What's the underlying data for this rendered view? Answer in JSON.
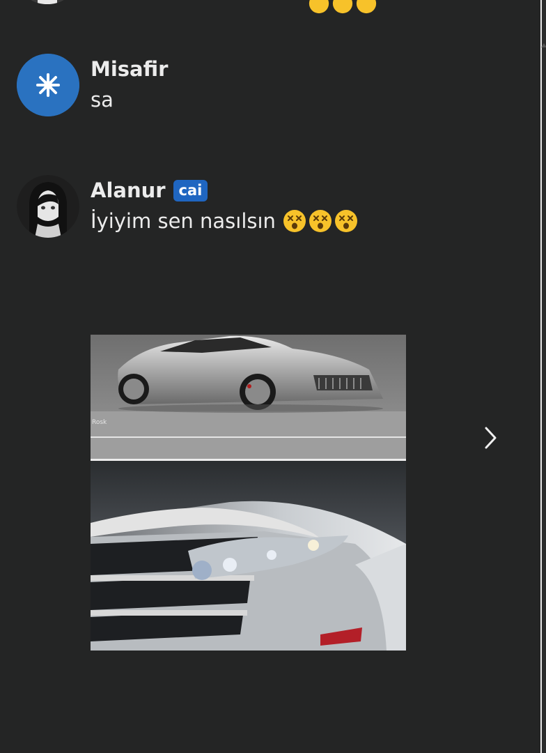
{
  "previous_message": {
    "emojis": [
      "dizzy-face",
      "dizzy-face",
      "dizzy-face"
    ]
  },
  "messages": [
    {
      "author": "Misafir",
      "avatar_icon": "star-burst-icon",
      "avatar_color": "#2a72c0",
      "text": "sa"
    },
    {
      "author": "Alanur",
      "badge": "cai",
      "avatar_icon": "anime-girl-avatar",
      "text": "İyiyim sen nasılsın",
      "emojis": [
        "dizzy-face",
        "dizzy-face",
        "dizzy-face"
      ]
    }
  ],
  "gallery": {
    "images": [
      "silver sports car side view",
      "silver car front grille close-up"
    ],
    "next_icon": "chevron-right-icon"
  },
  "colors": {
    "background": "#242525",
    "badge": "#1f66c1",
    "text": "#ececec"
  }
}
